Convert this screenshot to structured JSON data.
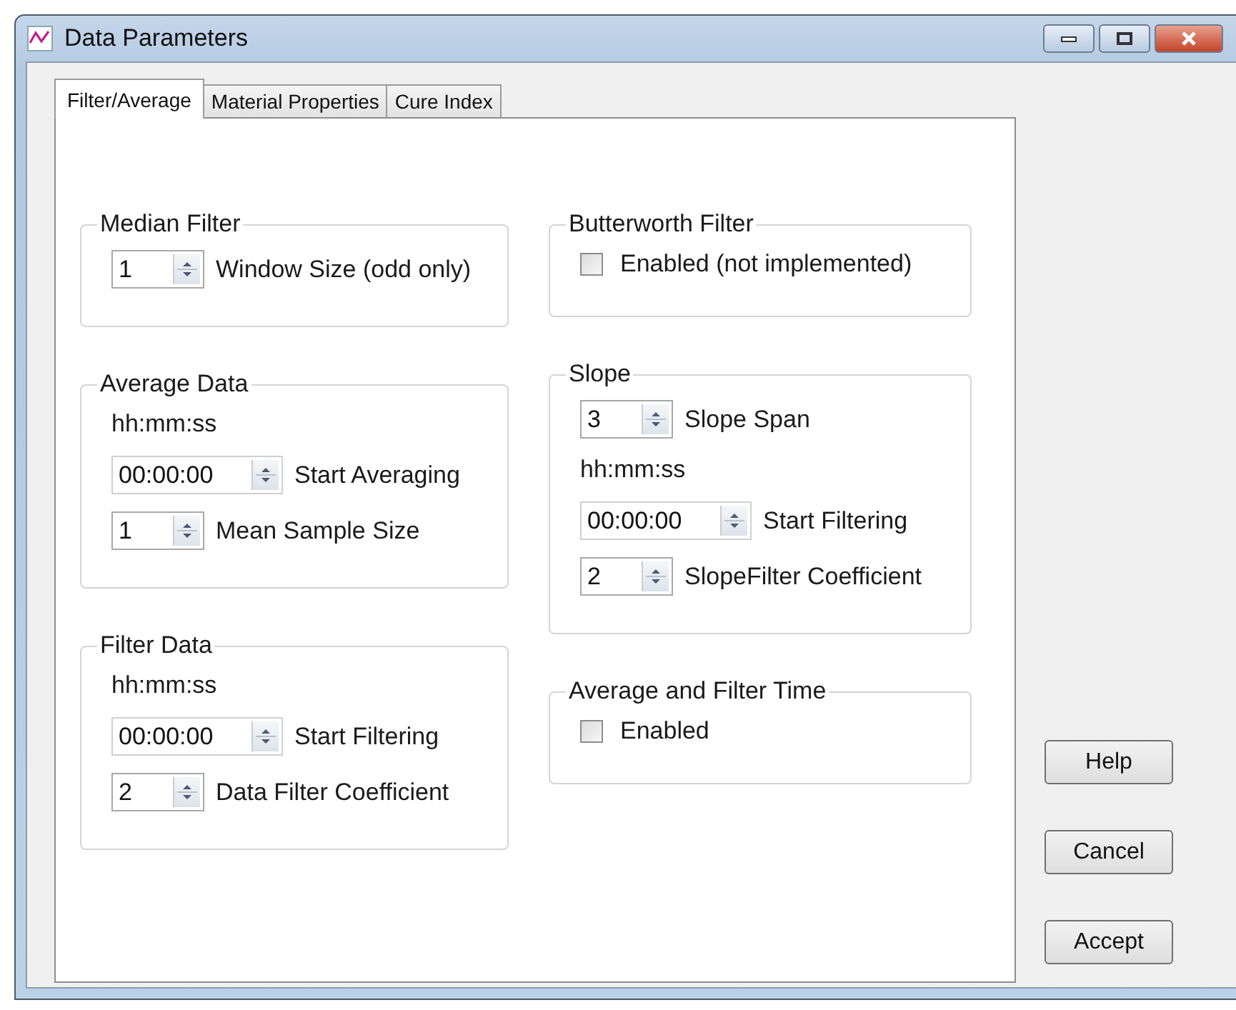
{
  "window": {
    "title": "Data Parameters"
  },
  "tabs": [
    {
      "label": "Filter/Average",
      "selected": true
    },
    {
      "label": "Material Properties",
      "selected": false
    },
    {
      "label": "Cure Index",
      "selected": false
    }
  ],
  "columns": [
    [
      {
        "title": "Median Filter",
        "rows": [
          {
            "kind": "spin",
            "value": "1",
            "label": "Window Size (odd only)"
          }
        ]
      },
      {
        "title": "Average Data",
        "rows": [
          {
            "kind": "caption",
            "text": "hh:mm:ss"
          },
          {
            "kind": "time",
            "time": "00:00:00",
            "label": "Start Averaging"
          },
          {
            "kind": "spin",
            "value": "1",
            "label": "Mean Sample Size"
          }
        ]
      },
      {
        "title": "Filter Data",
        "rows": [
          {
            "kind": "caption",
            "text": "hh:mm:ss"
          },
          {
            "kind": "time",
            "time": "00:00:00",
            "label": "Start Filtering"
          },
          {
            "kind": "spin",
            "value": "2",
            "label": "Data Filter Coefficient"
          }
        ]
      }
    ],
    [
      {
        "title": "Butterworth Filter",
        "rows": [
          {
            "kind": "checkbox",
            "label": "Enabled (not implemented)",
            "checked": false
          }
        ]
      },
      {
        "title": "Slope",
        "rows": [
          {
            "kind": "spin",
            "value": "3",
            "label": "Slope Span"
          },
          {
            "kind": "caption",
            "text": "hh:mm:ss"
          },
          {
            "kind": "time",
            "time": "00:00:00",
            "label": "Start Filtering"
          },
          {
            "kind": "spin",
            "value": "2",
            "label": "SlopeFilter Coefficient"
          }
        ]
      },
      {
        "title": "Average and Filter Time",
        "rows": [
          {
            "kind": "checkbox",
            "label": "Enabled",
            "checked": false
          }
        ]
      }
    ]
  ],
  "buttons": [
    "Help",
    "Cancel",
    "Accept"
  ]
}
